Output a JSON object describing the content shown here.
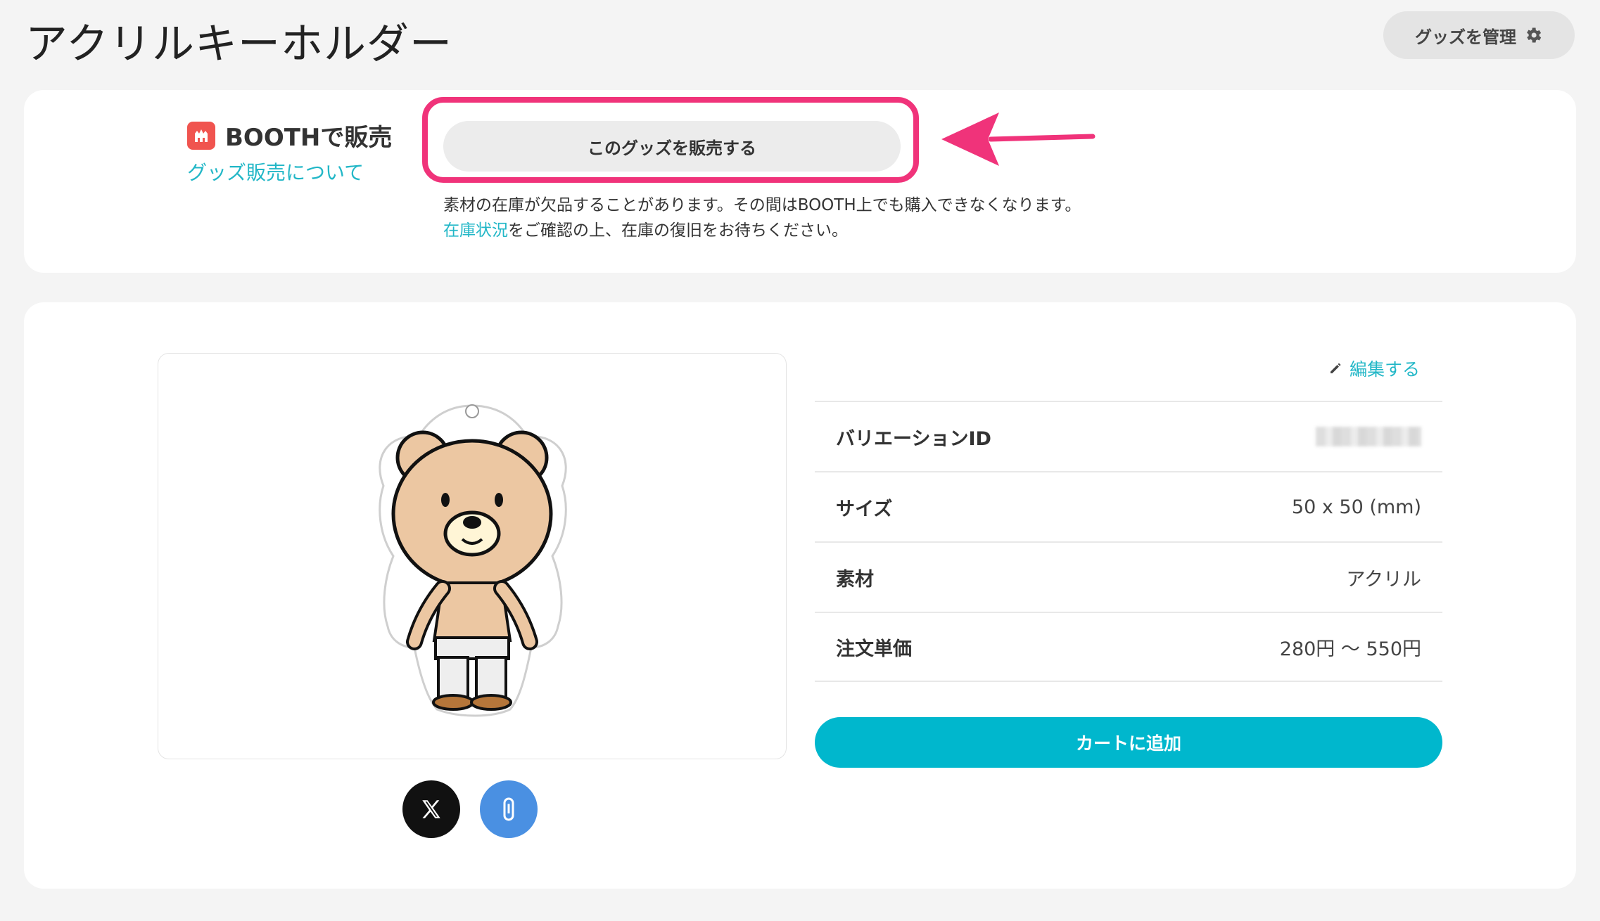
{
  "page": {
    "title": "アクリルキーホルダー"
  },
  "header": {
    "manage_label": "グッズを管理",
    "manage_icon": "gear-icon"
  },
  "booth": {
    "title": "BOOTHで販売",
    "about_link": "グッズ販売について",
    "sell_button": "このグッズを販売する",
    "note_line1": "素材の在庫が欠品することがあります。その間はBOOTH上でも購入できなくなります。",
    "note_link": "在庫状況",
    "note_line2_rest": "をご確認の上、在庫の復旧をお待ちください。",
    "highlight_color": "#f0337a"
  },
  "product": {
    "edit_label": "編集する",
    "specs": [
      {
        "label": "バリエーションID",
        "value": ""
      },
      {
        "label": "サイズ",
        "value": "50 x 50 (mm)"
      },
      {
        "label": "素材",
        "value": "アクリル"
      },
      {
        "label": "注文単価",
        "value": "280円 〜 550円"
      }
    ],
    "cart_button": "カートに追加",
    "share": {
      "x_icon": "x-logo-icon",
      "copy_icon": "clip-icon"
    }
  },
  "colors": {
    "accent": "#00b7cd",
    "link": "#22b7c7",
    "booth": "#f0544f"
  }
}
